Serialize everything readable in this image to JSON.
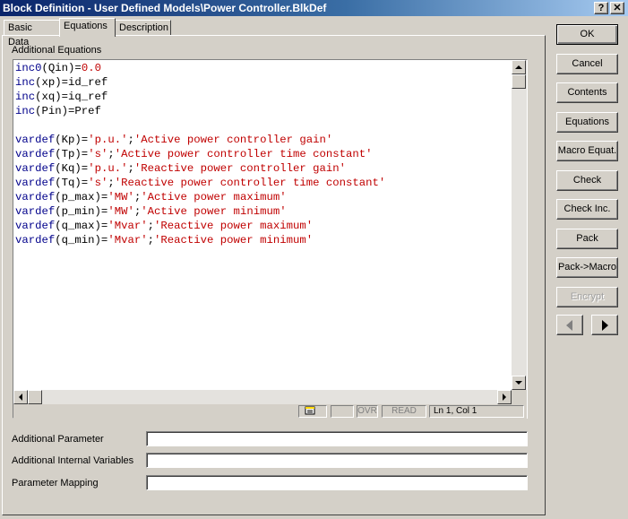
{
  "window": {
    "title": "Block Definition - User Defined Models\\Power Controller.BlkDef",
    "help_label": "?",
    "close_label": "✕"
  },
  "tabs": [
    {
      "label": "Basic Data"
    },
    {
      "label": "Equations"
    },
    {
      "label": "Description"
    }
  ],
  "editor": {
    "label": "Additional Equations",
    "lines": [
      [
        {
          "t": "inc0",
          "c": "kw"
        },
        {
          "t": "(Qin)=",
          "c": ""
        },
        {
          "t": "0.0",
          "c": "num"
        }
      ],
      [
        {
          "t": "inc",
          "c": "kw"
        },
        {
          "t": "(xp)=id_ref",
          "c": ""
        }
      ],
      [
        {
          "t": "inc",
          "c": "kw"
        },
        {
          "t": "(xq)=iq_ref",
          "c": ""
        }
      ],
      [
        {
          "t": "inc",
          "c": "kw"
        },
        {
          "t": "(Pin)=Pref",
          "c": ""
        }
      ],
      [],
      [
        {
          "t": "vardef",
          "c": "kw"
        },
        {
          "t": "(Kp)=",
          "c": ""
        },
        {
          "t": "'p.u.'",
          "c": "str"
        },
        {
          "t": ";",
          "c": ""
        },
        {
          "t": "'Active power controller gain'",
          "c": "str"
        }
      ],
      [
        {
          "t": "vardef",
          "c": "kw"
        },
        {
          "t": "(Tp)=",
          "c": ""
        },
        {
          "t": "'s'",
          "c": "str"
        },
        {
          "t": ";",
          "c": ""
        },
        {
          "t": "'Active power controller time constant'",
          "c": "str"
        }
      ],
      [
        {
          "t": "vardef",
          "c": "kw"
        },
        {
          "t": "(Kq)=",
          "c": ""
        },
        {
          "t": "'p.u.'",
          "c": "str"
        },
        {
          "t": ";",
          "c": ""
        },
        {
          "t": "'Reactive power controller gain'",
          "c": "str"
        }
      ],
      [
        {
          "t": "vardef",
          "c": "kw"
        },
        {
          "t": "(Tq)=",
          "c": ""
        },
        {
          "t": "'s'",
          "c": "str"
        },
        {
          "t": ";",
          "c": ""
        },
        {
          "t": "'Reactive power controller time constant'",
          "c": "str"
        }
      ],
      [
        {
          "t": "vardef",
          "c": "kw"
        },
        {
          "t": "(p_max)=",
          "c": ""
        },
        {
          "t": "'MW'",
          "c": "str"
        },
        {
          "t": ";",
          "c": ""
        },
        {
          "t": "'Active power maximum'",
          "c": "str"
        }
      ],
      [
        {
          "t": "vardef",
          "c": "kw"
        },
        {
          "t": "(p_min)=",
          "c": ""
        },
        {
          "t": "'MW'",
          "c": "str"
        },
        {
          "t": ";",
          "c": ""
        },
        {
          "t": "'Active power minimum'",
          "c": "str"
        }
      ],
      [
        {
          "t": "vardef",
          "c": "kw"
        },
        {
          "t": "(q_max)=",
          "c": ""
        },
        {
          "t": "'Mvar'",
          "c": "str"
        },
        {
          "t": ";",
          "c": ""
        },
        {
          "t": "'Reactive power maximum'",
          "c": "str"
        }
      ],
      [
        {
          "t": "vardef",
          "c": "kw"
        },
        {
          "t": "(q_min)=",
          "c": ""
        },
        {
          "t": "'Mvar'",
          "c": "str"
        },
        {
          "t": ";",
          "c": ""
        },
        {
          "t": "'Reactive power minimum'",
          "c": "str"
        }
      ]
    ],
    "status": {
      "ovr": "OVR",
      "read": "READ",
      "position": "Ln 1, Col 1"
    }
  },
  "fields": {
    "additional_parameter": {
      "label": "Additional Parameter",
      "value": ""
    },
    "additional_internal_variables": {
      "label": "Additional Internal Variables",
      "value": ""
    },
    "parameter_mapping": {
      "label": "Parameter Mapping",
      "value": ""
    }
  },
  "buttons": {
    "ok": "OK",
    "cancel": "Cancel",
    "contents": "Contents",
    "equations": "Equations",
    "macro_equat": "Macro Equat.",
    "check": "Check",
    "check_inc": "Check Inc.",
    "pack": "Pack",
    "pack_macro": "Pack->Macro",
    "encrypt": "Encrypt"
  },
  "colors": {
    "keyword": "#00008b",
    "string": "#c00000",
    "title_start": "#0a246a",
    "title_end": "#a6caf0"
  }
}
